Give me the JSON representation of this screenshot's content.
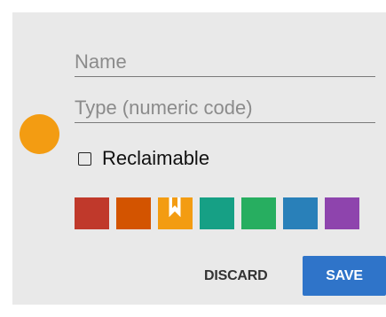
{
  "form": {
    "name_placeholder": "Name",
    "type_placeholder": "Type (numeric code)",
    "reclaimable_label": "Reclaimable",
    "reclaimable_checked": false
  },
  "selected_color": "#f39c12",
  "swatches": [
    {
      "color": "#c0392b",
      "selected": false
    },
    {
      "color": "#d35400",
      "selected": false
    },
    {
      "color": "#f39c12",
      "selected": true
    },
    {
      "color": "#16a085",
      "selected": false
    },
    {
      "color": "#27ae60",
      "selected": false
    },
    {
      "color": "#2980b9",
      "selected": false
    },
    {
      "color": "#8e44ad",
      "selected": false
    }
  ],
  "actions": {
    "discard_label": "DISCARD",
    "save_label": "SAVE",
    "save_color": "#2f74c9"
  }
}
